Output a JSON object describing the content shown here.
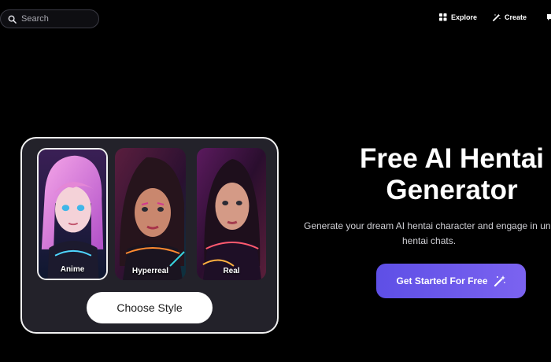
{
  "search": {
    "placeholder": "Search"
  },
  "nav": {
    "explore": {
      "label": "Explore",
      "icon": "grid-icon"
    },
    "create": {
      "label": "Create",
      "icon": "magic-wand-icon"
    }
  },
  "style_card": {
    "styles": [
      {
        "label": "Anime",
        "selected": true
      },
      {
        "label": "Hyperreal",
        "selected": false
      },
      {
        "label": "Real",
        "selected": false
      }
    ],
    "choose_button": "Choose Style"
  },
  "hero": {
    "title_line1": "Free AI Hentai",
    "title_line2": "Generator",
    "subtitle_line1": "Generate your dream AI hentai character and engage in und",
    "subtitle_line2": "hentai chats.",
    "cta_label": "Get Started For Free",
    "cta_icon": "magic-wand-icon"
  },
  "colors": {
    "background": "#000000",
    "card": "#23222a",
    "cta_start": "#5e4fe6",
    "cta_end": "#7b63f0"
  }
}
